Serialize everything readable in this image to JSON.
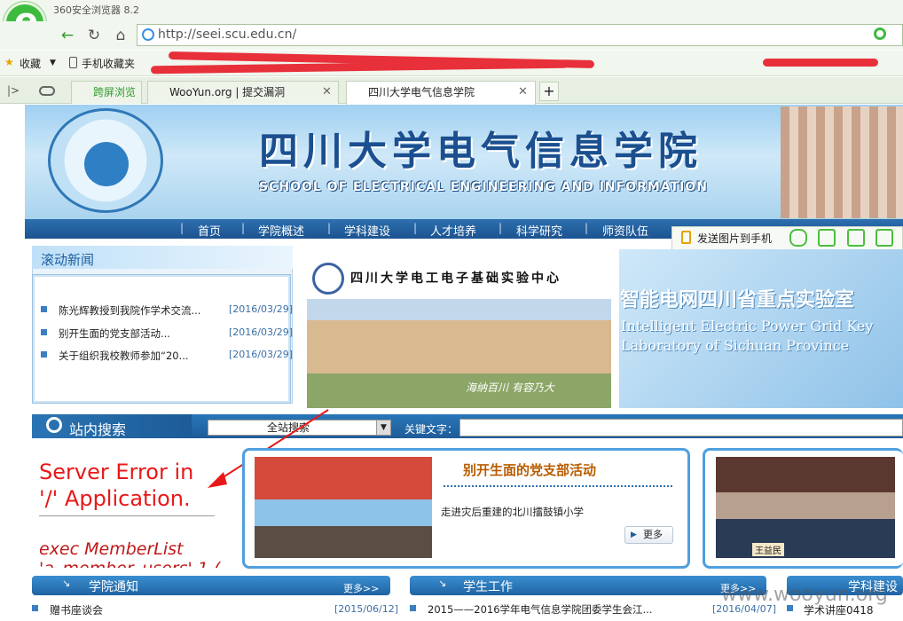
{
  "browser": {
    "app_title": "360安全浏览器 8.2",
    "url": "http://seei.scu.edu.cn/",
    "bookmarks": {
      "collect": "收藏",
      "mobile": "手机收藏夹"
    },
    "tabs": [
      {
        "label": "跨屏浏览"
      },
      {
        "label": "WooYun.org | 提交漏洞"
      },
      {
        "label": "四川大学电气信息学院"
      }
    ],
    "new_tab": "+"
  },
  "header": {
    "school_name": "四川大学电气信息学院",
    "school_name_en": "SCHOOL OF ELECTRICAL ENGINEERING AND INFORMATION",
    "menu": [
      "首页",
      "学院概述",
      "学科建设",
      "人才培养",
      "科学研究",
      "师资队伍"
    ]
  },
  "floatbar": {
    "send_label": "发送图片到手机"
  },
  "news": {
    "title": "滚动新闻",
    "items": [
      {
        "text": "陈光辉教授到我院作学术交流...",
        "date": "[2016/03/29]"
      },
      {
        "text": "别开生面的党支部活动...",
        "date": "[2016/03/29]"
      },
      {
        "text": "关于组织我校教师参加“20...",
        "date": "[2016/03/29]"
      }
    ]
  },
  "lab": {
    "title": "四川大学电工电子基础实验中心",
    "slogan": "海纳百川 有容乃大",
    "title2": "智能电网四川省重点实验室",
    "title2_en_1": "Intelligent Electric Power Grid Key",
    "title2_en_2": "Laboratory of Sichuan Province"
  },
  "search": {
    "label": "站内搜索",
    "scope": "全站搜索",
    "keyword_label": "关键文字："
  },
  "error": {
    "line1": "Server Error in",
    "line2": "'/' Application.",
    "line3": "exec MemberList",
    "line4": "'a_member_users',1,("
  },
  "feature": {
    "title": "别开生面的党支部活动",
    "desc": "走进灾后重建的北川擂鼓镇小学",
    "more": "更多",
    "person_name": "王益民"
  },
  "bottom": {
    "notice_title": "学院通知",
    "student_title": "学生工作",
    "discipline_title": "学科建设",
    "more": "更多>>",
    "notice_item": "赠书座谈会",
    "notice_date": "[2015/06/12]",
    "student_item": "2015——2016学年电气信息学院团委学生会江...",
    "student_date": "[2016/04/07]",
    "discipline_item": "学术讲座0418"
  },
  "watermark": "www.wooyun.org"
}
